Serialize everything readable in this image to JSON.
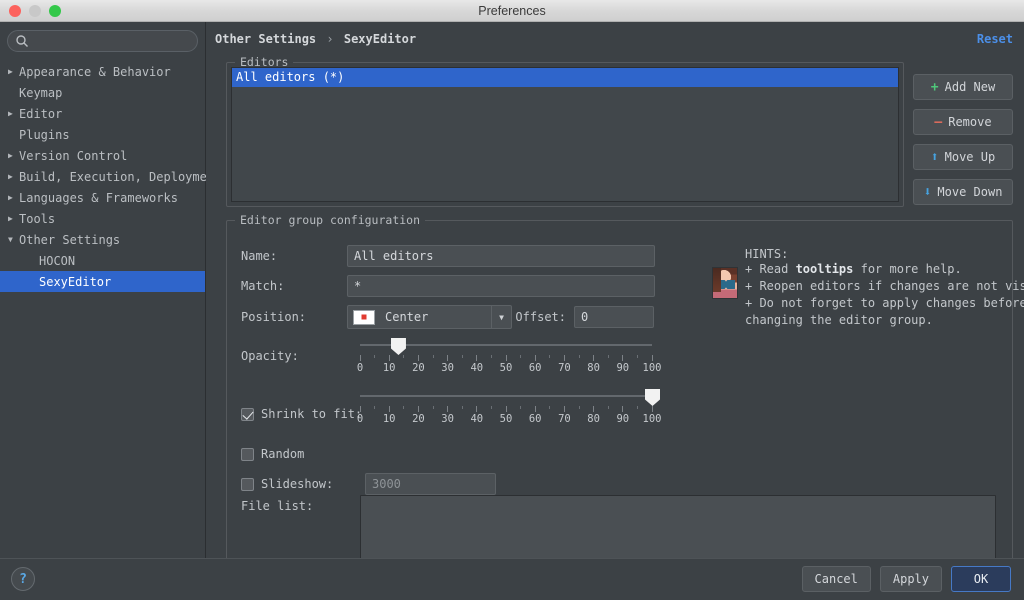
{
  "window": {
    "title": "Preferences",
    "traffic_lights": [
      "close-red",
      "minimize-gray",
      "zoom-green"
    ]
  },
  "sidebar": {
    "search": {
      "value": "",
      "placeholder": "",
      "icon": "search-icon"
    },
    "items": [
      {
        "label": "Appearance & Behavior",
        "arrow": "▶",
        "level": 1,
        "selected": false
      },
      {
        "label": "Keymap",
        "arrow": "",
        "level": 1,
        "selected": false
      },
      {
        "label": "Editor",
        "arrow": "▶",
        "level": 1,
        "selected": false
      },
      {
        "label": "Plugins",
        "arrow": "",
        "level": 1,
        "selected": false
      },
      {
        "label": "Version Control",
        "arrow": "▶",
        "level": 1,
        "selected": false
      },
      {
        "label": "Build, Execution, Deployment",
        "arrow": "▶",
        "level": 1,
        "selected": false
      },
      {
        "label": "Languages & Frameworks",
        "arrow": "▶",
        "level": 1,
        "selected": false
      },
      {
        "label": "Tools",
        "arrow": "▶",
        "level": 1,
        "selected": false
      },
      {
        "label": "Other Settings",
        "arrow": "▼",
        "level": 1,
        "selected": false
      },
      {
        "label": "HOCON",
        "arrow": "",
        "level": 2,
        "selected": false
      },
      {
        "label": "SexyEditor",
        "arrow": "",
        "level": 2,
        "selected": true
      }
    ]
  },
  "breadcrumb": {
    "parent": "Other Settings",
    "separator": "›",
    "current": "SexyEditor"
  },
  "reset_link": "Reset",
  "editors_group": {
    "title": "Editors",
    "rows": [
      {
        "label": "All editors (*)",
        "selected": true
      }
    ]
  },
  "side_buttons": [
    {
      "label": "Add New",
      "glyph": "+",
      "icon": "plus-icon",
      "color": "#4fc87a"
    },
    {
      "label": "Remove",
      "glyph": "—",
      "icon": "minus-icon",
      "color": "#d96a5c"
    },
    {
      "label": "Move Up",
      "glyph": "⬆",
      "icon": "arrow-up-icon",
      "color": "#46a3e0"
    },
    {
      "label": "Move Down",
      "glyph": "⬇",
      "icon": "arrow-down-icon",
      "color": "#46a3e0"
    }
  ],
  "config_group": {
    "title": "Editor group configuration",
    "name": {
      "label": "Name:",
      "value": "All editors",
      "placeholder": ""
    },
    "match": {
      "label": "Match:",
      "value": "*",
      "placeholder": ""
    },
    "position": {
      "label": "Position:",
      "selected": "Center",
      "icon": "position-center-icon",
      "arrow": "▼",
      "options": [
        "Center"
      ]
    },
    "offset": {
      "label": "Offset:",
      "value": "0",
      "placeholder": ""
    },
    "opacity": {
      "label": "Opacity:",
      "value": 13,
      "min": 0,
      "max": 100,
      "ticks": [
        0,
        10,
        20,
        30,
        40,
        50,
        60,
        70,
        80,
        90,
        100
      ]
    },
    "shrink": {
      "label": "Shrink to fit:",
      "checked": true,
      "value": 100,
      "min": 0,
      "max": 100,
      "ticks": [
        0,
        10,
        20,
        30,
        40,
        50,
        60,
        70,
        80,
        90,
        100
      ]
    },
    "random": {
      "label": "Random",
      "checked": false
    },
    "slideshow": {
      "label": "Slideshow:",
      "checked": false,
      "value": "",
      "placeholder": "3000"
    },
    "file_list": {
      "label": "File list:",
      "value": "",
      "placeholder": ""
    }
  },
  "hints": {
    "title": "HINTS:",
    "avatar": "avatar-image",
    "lines": [
      {
        "prefix": "+ Read ",
        "bold": "tooltips",
        "suffix": " for more help."
      },
      {
        "prefix": "+ Reopen editors if changes are not visible.",
        "bold": "",
        "suffix": ""
      },
      {
        "prefix": "+ Do not forget to apply changes before",
        "bold": "",
        "suffix": ""
      },
      {
        "prefix": "changing the editor group.",
        "bold": "",
        "suffix": ""
      }
    ]
  },
  "footer": {
    "help": "?",
    "buttons": [
      {
        "label": "Cancel",
        "primary": false
      },
      {
        "label": "Apply",
        "primary": false
      },
      {
        "label": "OK",
        "primary": true
      }
    ]
  },
  "colors": {
    "accent_selection": "#2f65cb",
    "link": "#4b8fe8",
    "background": "#3c4145",
    "panel": "#4a4f53",
    "ok_button": "#2b3c5c"
  }
}
